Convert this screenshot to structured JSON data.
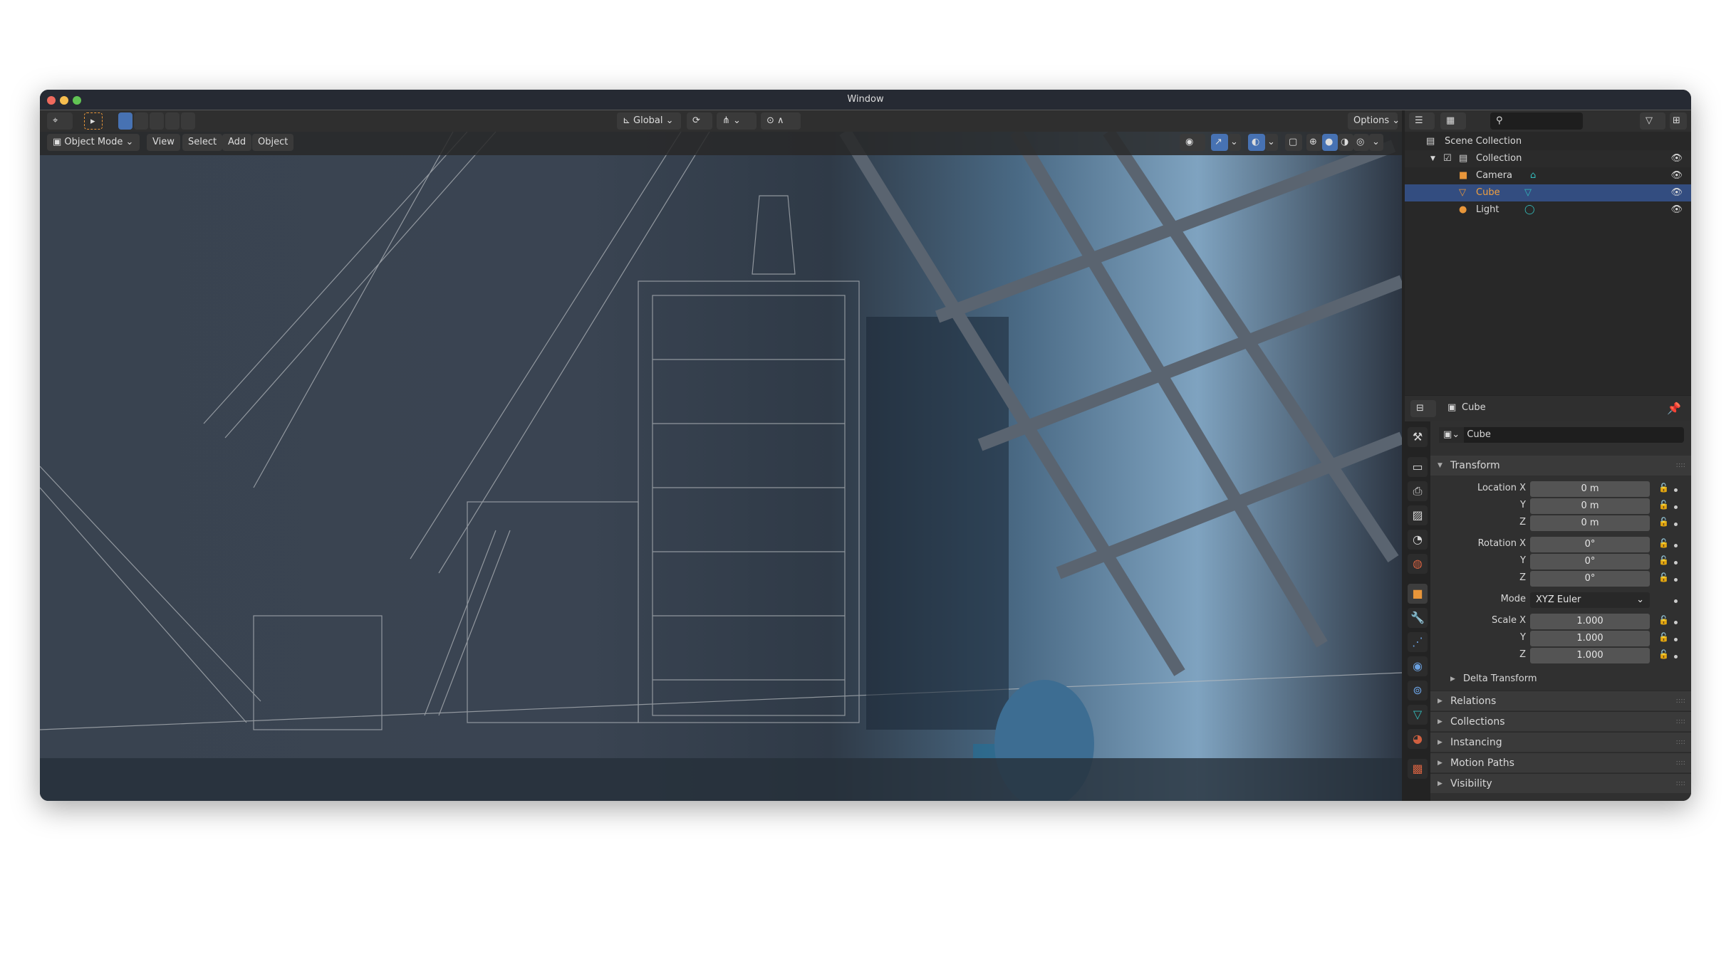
{
  "window": {
    "title": "Window"
  },
  "header": {
    "transform_orientation": "Global",
    "options": "Options"
  },
  "viewport_header": {
    "mode": "Object Mode",
    "menus": [
      "View",
      "Select",
      "Add",
      "Object"
    ]
  },
  "outliner": {
    "root": "Scene Collection",
    "collection": "Collection",
    "items": [
      {
        "name": "Camera",
        "type": "camera"
      },
      {
        "name": "Cube",
        "type": "mesh",
        "selected": true
      },
      {
        "name": "Light",
        "type": "light"
      }
    ]
  },
  "properties": {
    "object_name": "Cube",
    "datablock_name": "Cube",
    "transform": {
      "title": "Transform",
      "location_label": "Location X",
      "rotation_label": "Rotation X",
      "scale_label": "Scale X",
      "y": "Y",
      "z": "Z",
      "location": [
        "0 m",
        "0 m",
        "0 m"
      ],
      "rotation": [
        "0°",
        "0°",
        "0°"
      ],
      "mode_label": "Mode",
      "mode": "XYZ Euler",
      "scale": [
        "1.000",
        "1.000",
        "1.000"
      ],
      "delta": "Delta Transform"
    },
    "panels": [
      "Relations",
      "Collections",
      "Instancing",
      "Motion Paths",
      "Visibility"
    ]
  },
  "colors": {
    "accent": "#4772b3",
    "selected_row": "#334d80",
    "object_orange": "#e8963a"
  }
}
